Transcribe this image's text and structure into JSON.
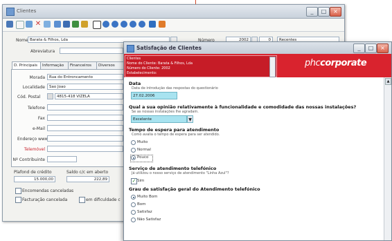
{
  "back_window": {
    "title": "Clientes",
    "nome_label": "Nome",
    "nome_value": "Barata & Filhos, Lda",
    "numero_label": "Número",
    "numero_value": "2002",
    "numero_sub": "0",
    "recentes_value": "Recentes",
    "abreviatura_label": "Abreviatura",
    "tabs": [
      "D. Principais",
      "Informação",
      "Financeiros",
      "Diversos"
    ],
    "fields": [
      {
        "label": "Morada",
        "value": "Rua do Entroncamento"
      },
      {
        "label": "Localidade",
        "value": "Sao Joao"
      },
      {
        "label": "Cód. Postal",
        "value": "4815-418 VIZELA"
      },
      {
        "label": "Telefone",
        "value": ""
      },
      {
        "label": "Fax",
        "value": ""
      },
      {
        "label": "e-Mail",
        "value": ""
      },
      {
        "label": "Endereço www",
        "value": ""
      },
      {
        "label": "Telemóvel",
        "value": ""
      },
      {
        "label": "Nº Contribuinte",
        "value": ""
      }
    ],
    "plafond_label": "Plafond de crédito",
    "plafond_value": "15.000,00",
    "saldo_label": "Saldo c/c em aberto",
    "saldo_value": "222,89",
    "check_encomendas": "Encomendas canceladas",
    "check_facturacao": "Facturação cancelada",
    "check_dificuldade": "em dificuldade c"
  },
  "front_window": {
    "title": "Satisfação de Clientes",
    "header_lines": [
      "Clientes",
      "Nome do Cliente: Barata & Filhos, Lda",
      "Número do Cliente:      2002",
      "Estabelecimento:"
    ],
    "logo_main": "phc",
    "logo_rest": "corporate",
    "sections": [
      {
        "title": "Data",
        "subtitle": "Data de introdução das respostas do questionário",
        "value": "27.02.2006"
      },
      {
        "title": "Qual a sua opinião relativamente à funcionalidade e comodidade das nossas instalações?",
        "subtitle": "Se as nossas instalações lhe agradam.",
        "value": "Excelente"
      },
      {
        "title": "Tempo de espera para atendimento",
        "subtitle": "Como avalia o tempo de espera para ser atendido.",
        "options": [
          "Muito",
          "Normal",
          "Pouco"
        ],
        "selected": "Pouco"
      },
      {
        "title": "Serviço de atendimento telefónico",
        "subtitle": "Já utilizou o nosso serviço de atendimento \"Linha Azul\"?",
        "check_label": "Sim",
        "checked": true
      },
      {
        "title": "Grau de satisfação geral do Atendimento telefónico",
        "options": [
          "Muito Bom",
          "Bom",
          "Satisfaz",
          "Não Satisfaz"
        ],
        "selected": "Muito Bom"
      }
    ]
  },
  "colors": {
    "brand_red": "#d9232e",
    "selection_blue": "#a8e3f0"
  }
}
